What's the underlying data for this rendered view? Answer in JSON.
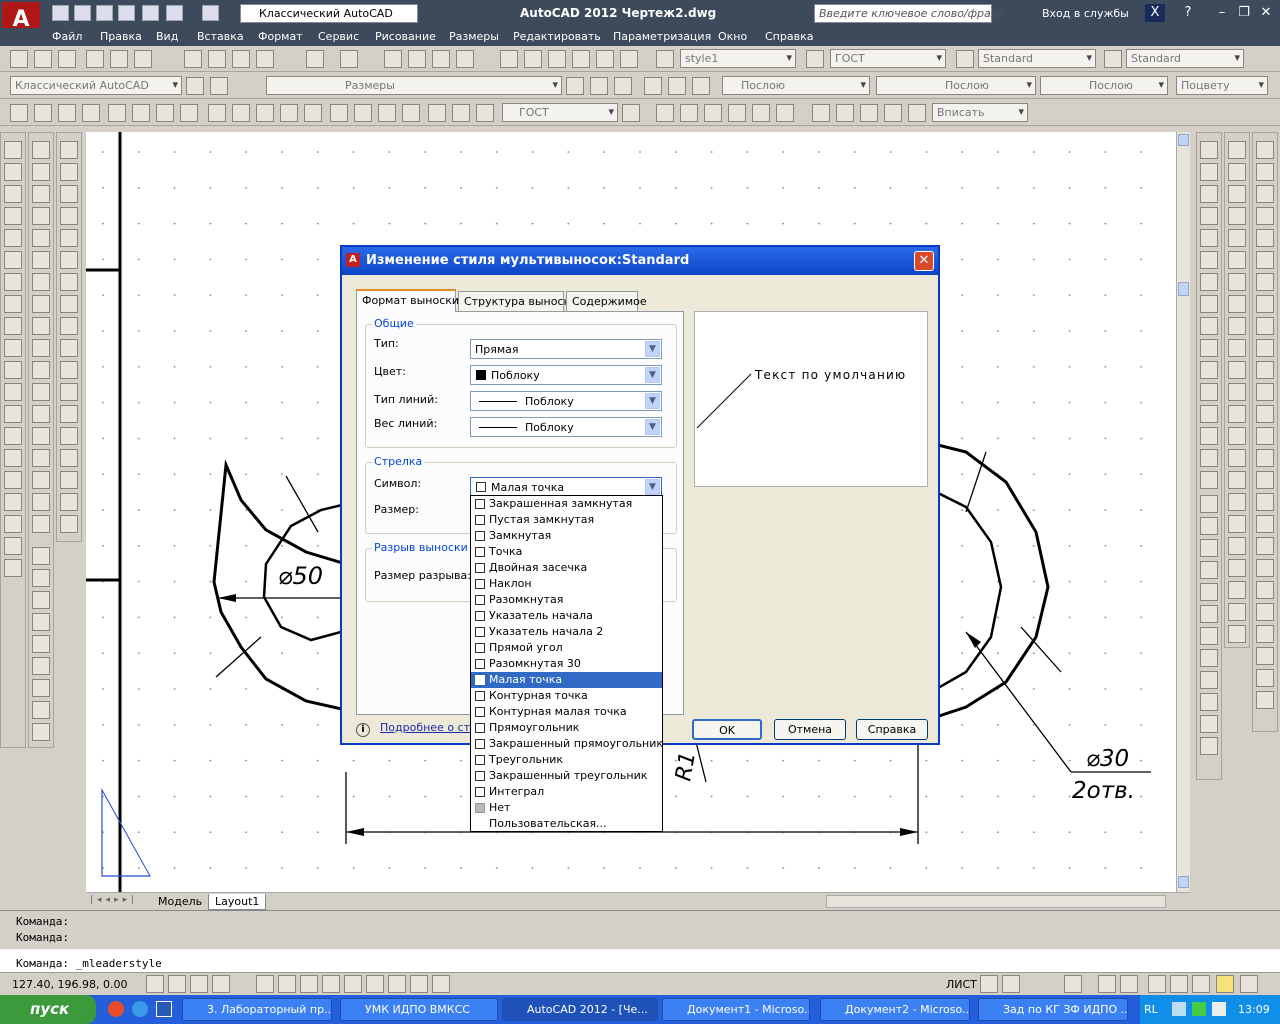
{
  "app": {
    "title": "AutoCAD 2012     Чертеж2.dwg",
    "workspace": "Классический AutoCAD",
    "search_placeholder": "Введите ключевое слово/фразу",
    "login": "Вход в службы"
  },
  "menu": [
    "Файл",
    "Правка",
    "Вид",
    "Вставка",
    "Формат",
    "Сервис",
    "Рисование",
    "Размеры",
    "Редактировать",
    "Параметризация",
    "Окно",
    "Справка"
  ],
  "toolbar2": {
    "text_style": "style1",
    "dim_style": "ГОСТ",
    "table_style": "Standard",
    "mleader_style": "Standard"
  },
  "toolbar3": {
    "workspace": "Классический AutoCAD",
    "layer": "Размеры",
    "color": "Послою",
    "linetype": "Послою",
    "lineweight": "Послою",
    "plotstyle": "Поцвету"
  },
  "toolbar4": {
    "dimstyle": "ГОСТ",
    "viewport_scale": "Вписать"
  },
  "drawing": {
    "dim_d50": "⌀50",
    "dim_d30": "⌀30",
    "holes": "2отв.",
    "radius": "R1"
  },
  "layout_tabs": [
    "Модель",
    "Layout1"
  ],
  "command_lines": [
    "Команда:",
    "Команда:",
    "Команда:  _mleaderstyle"
  ],
  "status": {
    "coords": "127.40, 196.98, 0.00",
    "sheet": "ЛИСТ"
  },
  "taskbar": {
    "start": "пуск",
    "tasks": [
      "3. Лабораторный пр...",
      "УМК ИДПО ВМКСС",
      "AutoCAD 2012 - [Че...",
      "Документ1 - Microso...",
      "Документ2 - Microso...",
      "Зад по КГ ЗФ ИДПО ..."
    ],
    "lang": "RL",
    "clock": "13:09"
  },
  "dialog": {
    "title": "Изменение стиля мультивыносок:Standard",
    "tabs": [
      "Формат выноски",
      "Структура выноски",
      "Содержимое"
    ],
    "group_general": "Общие",
    "type_label": "Тип:",
    "type_value": "Прямая",
    "color_label": "Цвет:",
    "color_value": "Поблоку",
    "linetype_label": "Тип линий:",
    "linetype_value": "Поблоку",
    "lineweight_label": "Вес линий:",
    "lineweight_value": "Поблоку",
    "group_arrow": "Стрелка",
    "symbol_label": "Символ:",
    "symbol_value": "Малая точка",
    "size_label": "Размер:",
    "group_break": "Разрыв выноски",
    "break_label": "Размер разрыва:",
    "preview_text": "Текст по умолчанию",
    "info_link": "Подробнее о стилях мультивыносок",
    "ok": "OK",
    "cancel": "Отмена",
    "help": "Справка",
    "symbol_options": [
      "Закрашенная замкнутая",
      "Пустая замкнутая",
      "Замкнутая",
      "Точка",
      "Двойная засечка",
      "Наклон",
      "Разомкнутая",
      "Указатель начала",
      "Указатель начала 2",
      "Прямой угол",
      "Разомкнутая 30",
      "Малая точка",
      "Контурная точка",
      "Контурная малая точка",
      "Прямоугольник",
      "Закрашенный прямоугольник",
      "Треугольник",
      "Закрашенный треугольник",
      "Интеграл",
      "Нет",
      "Пользовательская..."
    ],
    "selected_option": "Малая точка"
  }
}
